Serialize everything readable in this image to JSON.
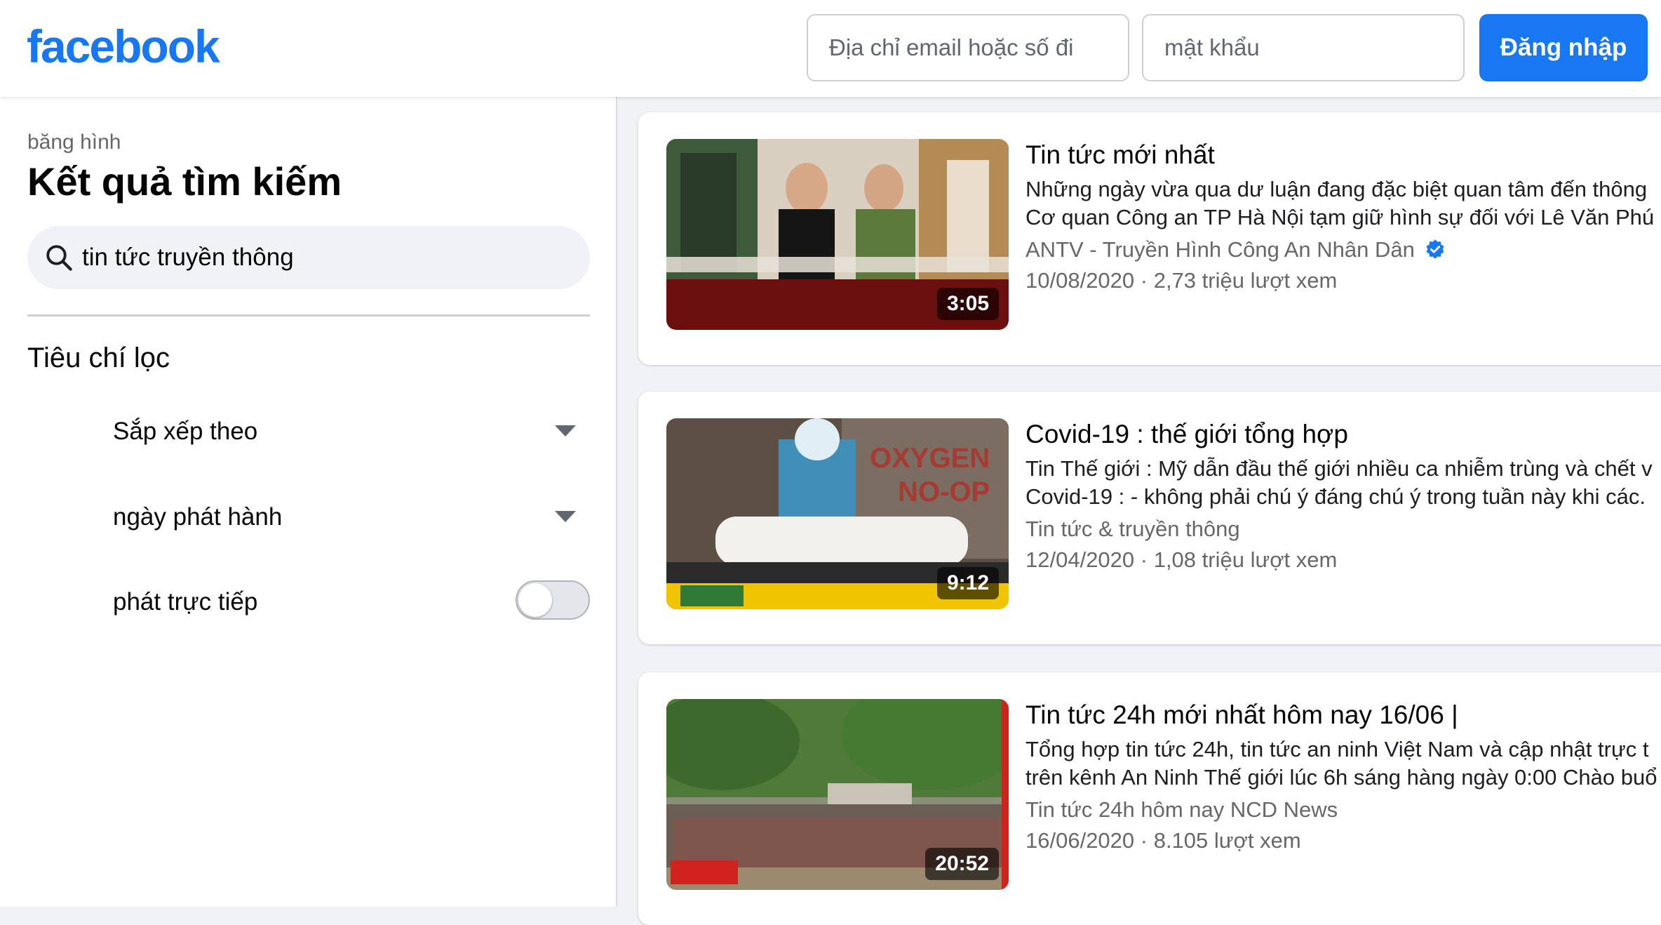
{
  "header": {
    "logo": "facebook",
    "email_placeholder": "Địa chỉ email hoặc số đi",
    "password_placeholder": "mật khẩu",
    "login_label": "Đăng nhập",
    "brand_color": "#1877f2"
  },
  "sidebar": {
    "breadcrumb": "băng hình",
    "title": "Kết quả tìm kiếm",
    "search_value": "tin tức truyền thông",
    "filters_title": "Tiêu chí lọc",
    "filters": [
      {
        "label": "Sắp xếp theo",
        "control": "dropdown"
      },
      {
        "label": "ngày phát hành",
        "control": "dropdown"
      },
      {
        "label": "phát trực tiếp",
        "control": "toggle",
        "state": "off"
      }
    ]
  },
  "results": [
    {
      "title": "Tin tức mới nhất",
      "desc1": "Những ngày vừa qua dư luận đang đặc biệt quan tâm đến thông",
      "desc2": "Cơ quan Công an TP Hà Nội tạm giữ hình sự đối với Lê Văn Phú (",
      "channel": "ANTV - Truyền Hình Công An Nhân Dân",
      "verified": true,
      "meta": "10/08/2020 · 2,73 triệu lượt xem",
      "duration": "3:05"
    },
    {
      "title": "Covid-19 : thế giới tổng hợp",
      "desc1": "Tin Thế giới : Mỹ dẫn đầu thế giới nhiều ca nhiễm trùng và chết v",
      "desc2": "Covid-19 : - không phải chú ý đáng chú ý trong tuần này khi các.",
      "channel": "Tin tức & truyền thông",
      "verified": false,
      "meta": "12/04/2020 · 1,08 triệu lượt xem",
      "duration": "9:12"
    },
    {
      "title": "Tin tức 24h mới nhất hôm nay 16/06 |",
      "desc1": "Tổng hợp tin tức 24h, tin tức an ninh Việt Nam và cập nhật trực t",
      "desc2": "trên kênh An Ninh Thế giới lúc 6h sáng hàng ngày 0:00 Chào buổ",
      "channel": "Tin tức 24h hôm nay NCD News",
      "verified": false,
      "meta": "16/06/2020 · 8.105 lượt xem",
      "duration": "20:52"
    }
  ]
}
